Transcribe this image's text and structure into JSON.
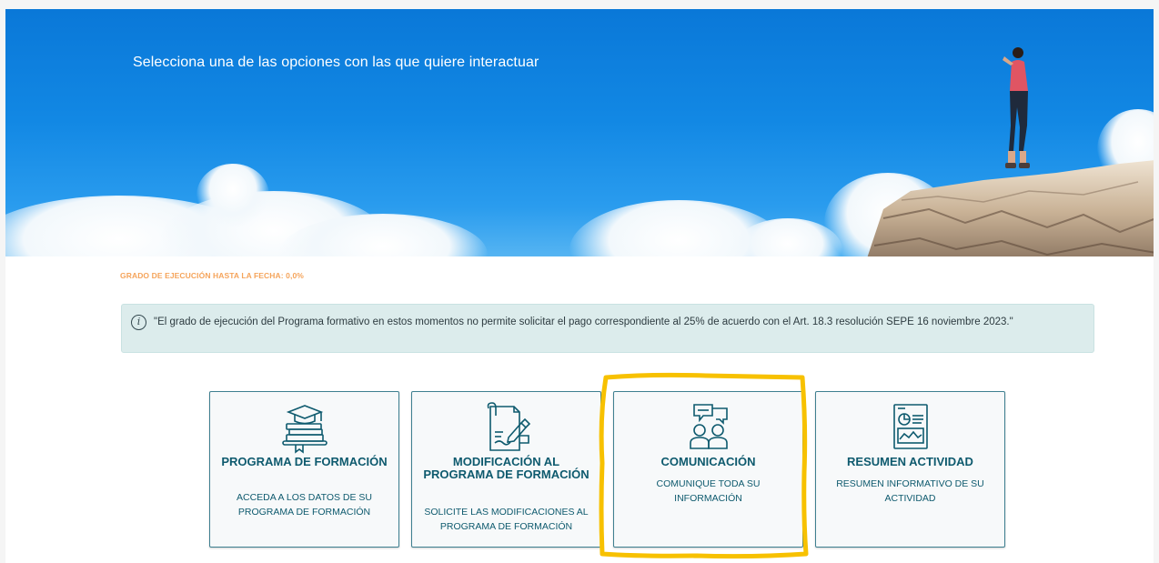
{
  "hero": {
    "title": "Selecciona una de las opciones con las que quiere interactuar"
  },
  "progress": {
    "label": "GRADO DE EJECUCIÓN HASTA LA FECHA: 0,0%"
  },
  "alert": {
    "icon": "info-icon",
    "text": "\"El grado de ejecución del Programa formativo en estos momentos no permite solicitar el pago correspondiente al 25% de acuerdo con el Art. 18.3 resolución SEPE 16 noviembre 2023.\""
  },
  "cards": [
    {
      "icon": "graduation-books-icon",
      "title": "PROGRAMA DE FORMACIÓN",
      "description": "ACCEDA A LOS DATOS DE SU PROGRAMA DE FORMACIÓN"
    },
    {
      "icon": "document-signature-icon",
      "title": "MODIFICACIÓN AL PROGRAMA DE FORMACIÓN",
      "description": "SOLICITE LAS MODIFICACIONES AL PROGRAMA DE FORMACIÓN"
    },
    {
      "icon": "people-chat-icon",
      "title": "COMUNICACIÓN",
      "description": "COMUNIQUE TODA SU INFORMACIÓN"
    },
    {
      "icon": "report-chart-icon",
      "title": "RESUMEN ACTIVIDAD",
      "description": "RESUMEN INFORMATIVO DE SU ACTIVIDAD"
    }
  ],
  "colors": {
    "hero_sky": "#0a78d8",
    "progress_label": "#f5a45b",
    "alert_background": "#dcecec",
    "card_text": "#0e5a6e",
    "highlight": "#f7c100"
  }
}
